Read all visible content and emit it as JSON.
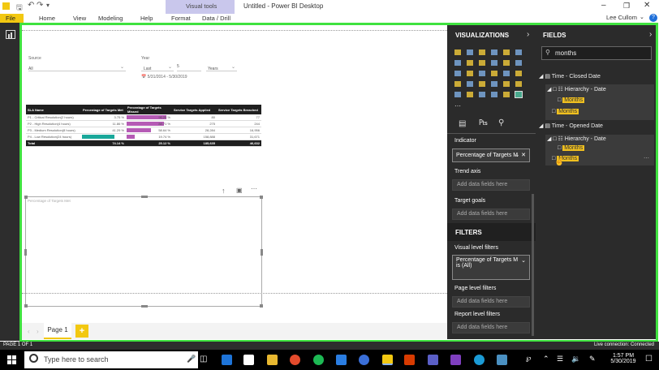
{
  "window": {
    "title": "Untitled - Power BI Desktop",
    "user": "Lee Cullom"
  },
  "ribbon": {
    "context_group": "Visual tools",
    "tabs": [
      "File",
      "Home",
      "View",
      "Modeling",
      "Help",
      "Format",
      "Data / Drill"
    ]
  },
  "slicer": {
    "source_label": "Source",
    "source_value": "All",
    "year_label": "Year",
    "year_mode": "Last",
    "year_count": "5",
    "year_unit": "Years",
    "date_range": "5/31/2014 - 5/30/2019"
  },
  "table": {
    "headers": [
      "SLA Name",
      "Percentage of Targets Met",
      "Percentage of Targets Missed",
      "Service Targets Applied",
      "Service Targets Breached"
    ],
    "rows": [
      [
        "P1 - Critical Resolution(2 hours)",
        "3.75 %",
        "96.25 %",
        "80",
        "77"
      ],
      [
        "P2 - High Resolution(4 hours)",
        "11.86 %",
        "88.71 %",
        "275",
        "244"
      ],
      [
        "P3 - Medium Resolution(8 hours)",
        "41.29 %",
        "58.64 %",
        "28,284",
        "16,956"
      ],
      [
        "P4 - Low Resolution(24 hours)",
        "",
        "19.74 %",
        "158,888",
        "31,671"
      ]
    ],
    "total": [
      "Total",
      "74.14 %",
      "25.12 %",
      "185,635",
      "46,632"
    ],
    "missed_fraction": [
      0.9625,
      0.8871,
      0.5864,
      0.1974
    ],
    "met_fraction": [
      0.0375,
      0.1186,
      0.4129,
      0.8026
    ]
  },
  "kpi_visual": {
    "placeholder": "Percentage of Targets Met"
  },
  "pages": {
    "current": "Page 1",
    "add_label": "+"
  },
  "visualizations": {
    "title": "VISUALIZATIONS",
    "indicator_label": "Indicator",
    "indicator_value": "Percentage of Targets M",
    "trend_label": "Trend axis",
    "trend_placeholder": "Add data fields here",
    "target_label": "Target goals",
    "target_placeholder": "Add data fields here"
  },
  "filters": {
    "title": "FILTERS",
    "visual_level": "Visual level filters",
    "visual_filter_value": "Percentage of Targets M",
    "visual_filter_sub": "is (All)",
    "page_level": "Page level filters",
    "page_placeholder": "Add data fields here",
    "report_level": "Report level filters",
    "report_placeholder": "Add data fields here"
  },
  "fields": {
    "title": "FIELDS",
    "search_value": "months",
    "tables": [
      {
        "name": "Time - Closed Date",
        "hierarchy": "Hierarchy - Date",
        "hier_child": "Months",
        "field": "Months"
      },
      {
        "name": "Time - Opened Date",
        "hierarchy": "Hierarchy - Date",
        "hier_child": "Months",
        "field": "Months"
      }
    ]
  },
  "status": {
    "page": "PAGE 1 OF 1",
    "connection": "Live connection: Connected"
  },
  "taskbar": {
    "search_placeholder": "Type here to search",
    "time": "1:57 PM",
    "date": "5/30/2019"
  },
  "colors": {
    "green_frame": "#3fe23f",
    "missed_bar": "#b55bb5",
    "met_bar": "#1aa89a",
    "highlight": "#f0c020",
    "pane": "#2b2b2b"
  }
}
